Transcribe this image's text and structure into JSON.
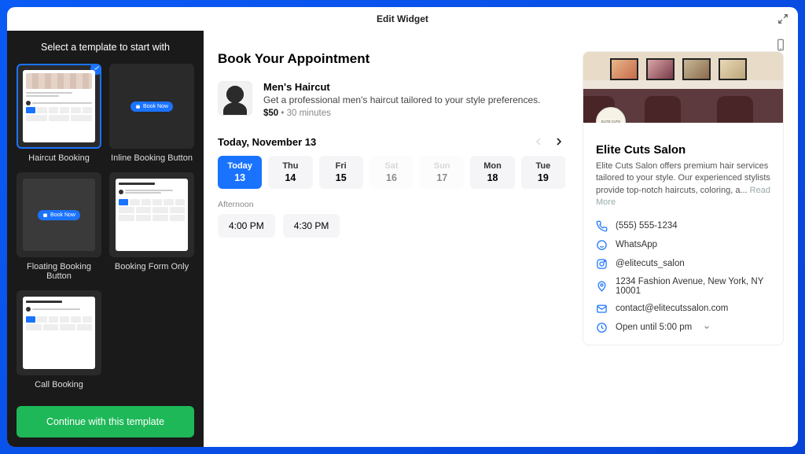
{
  "window": {
    "title": "Edit Widget"
  },
  "sidebar": {
    "title": "Select a template to start with",
    "continue_label": "Continue with this template",
    "templates": [
      {
        "label": "Haircut Booking",
        "selected": true
      },
      {
        "label": "Inline Booking Button"
      },
      {
        "label": "Floating Booking Button"
      },
      {
        "label": "Booking Form Only"
      },
      {
        "label": "Call Booking"
      }
    ],
    "mock_button_label": "Book Now"
  },
  "booking": {
    "heading": "Book Your Appointment",
    "service": {
      "name": "Men's Haircut",
      "description": "Get a professional men's haircut tailored to your style preferences.",
      "price": "$50",
      "duration": "30 minutes"
    },
    "date_title": "Today, November 13",
    "days": [
      {
        "dow": "Today",
        "num": "13",
        "state": "selected"
      },
      {
        "dow": "Thu",
        "num": "14",
        "state": "normal"
      },
      {
        "dow": "Fri",
        "num": "15",
        "state": "normal"
      },
      {
        "dow": "Sat",
        "num": "16",
        "state": "disabled"
      },
      {
        "dow": "Sun",
        "num": "17",
        "state": "disabled"
      },
      {
        "dow": "Mon",
        "num": "18",
        "state": "normal"
      },
      {
        "dow": "Tue",
        "num": "19",
        "state": "normal"
      }
    ],
    "section_label": "Afternoon",
    "times": [
      "4:00 PM",
      "4:30 PM"
    ]
  },
  "business": {
    "logo_text": "ELITE CUTS",
    "name": "Elite Cuts Salon",
    "description": "Elite Cuts Salon offers premium hair services tailored to your style. Our experienced stylists provide top-notch haircuts, coloring, a...",
    "read_more": "Read More",
    "rows": [
      {
        "icon": "phone-icon",
        "text": "(555) 555-1234"
      },
      {
        "icon": "whatsapp-icon",
        "text": "WhatsApp"
      },
      {
        "icon": "instagram-icon",
        "text": "@elitecuts_salon"
      },
      {
        "icon": "location-icon",
        "text": "1234 Fashion Avenue, New York, NY 10001"
      },
      {
        "icon": "email-icon",
        "text": "contact@elitecutssalon.com"
      },
      {
        "icon": "clock-icon",
        "text": "Open until 5:00 pm",
        "chevron": true
      }
    ]
  }
}
